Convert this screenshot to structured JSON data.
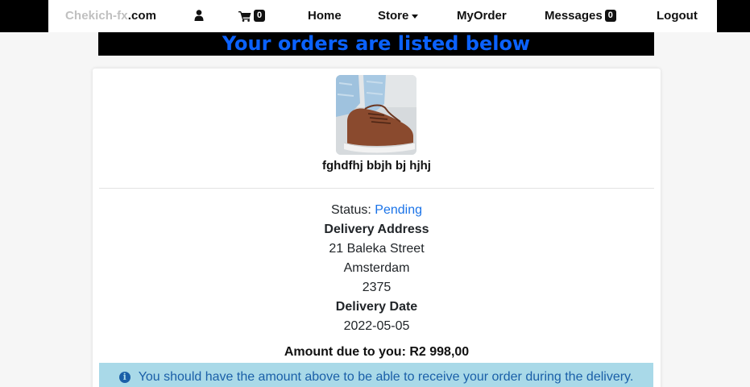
{
  "nav": {
    "brand_part1": "Chekich-fx",
    "brand_part2": ".com",
    "user_icon": "user-icon",
    "cart_icon": "shopping-cart-icon",
    "cart_count": "0",
    "home": "Home",
    "store": "Store",
    "myorder": "MyOrder",
    "messages": "Messages",
    "messages_count": "0",
    "logout": "Logout"
  },
  "banner": {
    "title": "Your orders are listed below"
  },
  "order": {
    "product_name": "fghdfhj bbjh bj hjhj",
    "status_label": "Status:",
    "status_value": "Pending",
    "delivery_address_label": "Delivery Address",
    "address_line1": "21 Baleka Street",
    "address_city": "Amsterdam",
    "address_code": "2375",
    "delivery_date_label": "Delivery Date",
    "delivery_date": "2022-05-05",
    "amount_label": "Amount due to you: R2 998,00",
    "notice": "You should have the amount above to be able to receive your order during the delivery."
  },
  "colors": {
    "banner_bg": "#000000",
    "banner_text": "#0b62ff",
    "status_link": "#1a73e8",
    "alert_bg": "#a9d9e8",
    "alert_text": "#1a5fa8"
  }
}
